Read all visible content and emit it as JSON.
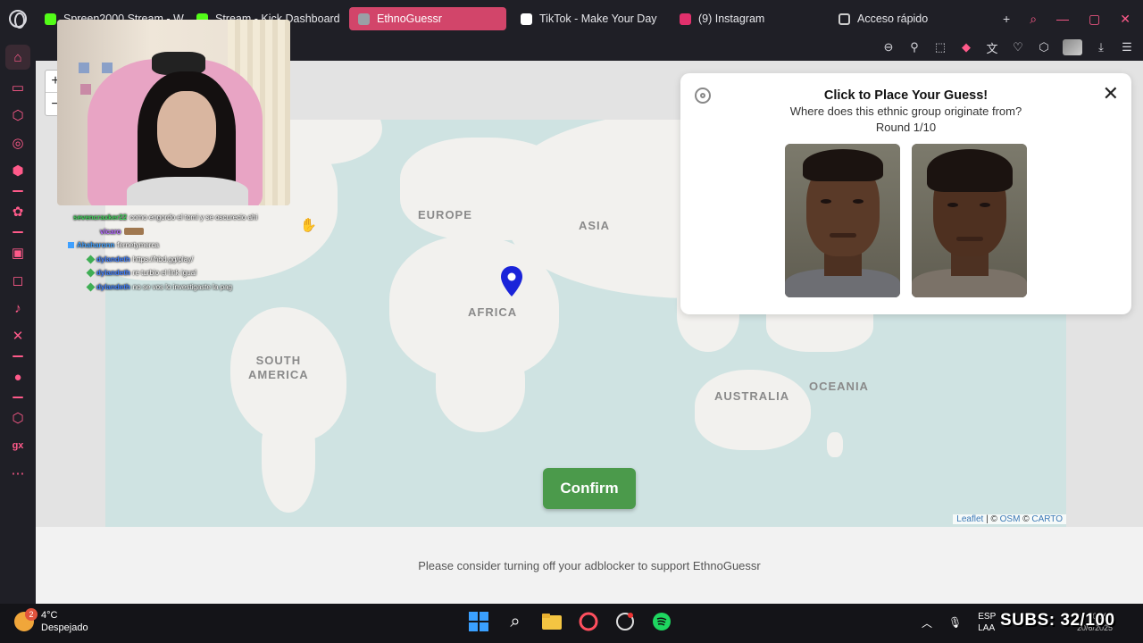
{
  "browser": {
    "tabs": [
      {
        "label": "Spreen2000 Stream - W",
        "icon": "kick-icon",
        "color": "#53fc18",
        "active": false
      },
      {
        "label": "Stream - Kick Dashboard",
        "icon": "kick-icon",
        "color": "#53fc18",
        "active": false
      },
      {
        "label": "EthnoGuessr",
        "icon": "ethnoguessr-icon",
        "color": "#9aa0a6",
        "active": true
      },
      {
        "label": "TikTok - Make Your Day",
        "icon": "tiktok-icon",
        "color": "#ffffff",
        "active": false
      },
      {
        "label": "(9) Instagram",
        "icon": "instagram-icon",
        "color": "#e1306c",
        "active": false
      },
      {
        "label": "Acceso rápido",
        "icon": "grid-icon",
        "color": "#cccccc",
        "active": false
      }
    ],
    "accent_color": "#d2456a"
  },
  "map": {
    "labels": {
      "europe": "EUROPE",
      "asia": "ASIA",
      "africa": "AFRICA",
      "south_america_1": "SOUTH",
      "south_america_2": "AMERICA",
      "australia": "AUSTRALIA",
      "oceania": "OCEANIA"
    },
    "zoom_in": "+",
    "zoom_out": "−",
    "attribution": {
      "leaflet": "Leaflet",
      "sep1": " | © ",
      "osm": "OSM",
      "sep2": " © ",
      "carto": "CARTO"
    },
    "pin_color": "#1a24d9"
  },
  "panel": {
    "title": "Click to Place Your Guess!",
    "subtitle": "Where does this ethnic group originate from?",
    "round": "Round 1/10",
    "close": "✕"
  },
  "confirm_label": "Confirm",
  "confirm_color": "#4b9a4b",
  "footer_text": "Please consider turning off your adblocker to support EthnoGuessr",
  "chat": [
    {
      "user": "sevencraxker22",
      "user_color": "#3fd15a",
      "text": "como engordo el tomi y se oscurecio ahi"
    },
    {
      "user": "vicaro",
      "user_color": "#b56bff",
      "text": ""
    },
    {
      "user": "Ahaharonn",
      "user_color": "#3fa0ff",
      "text": "fernetymerca"
    },
    {
      "user": "dylandeth",
      "user_color": "#3f7fff",
      "text": "https://hbd.gg/play/"
    },
    {
      "user": "dylandeth",
      "user_color": "#3f7fff",
      "text": "re turbio el link igual"
    },
    {
      "user": "dylandeth",
      "user_color": "#3f7fff",
      "text": "no se vos lo investigaste la pag"
    }
  ],
  "taskbar": {
    "weather_temp": "4°C",
    "weather_desc": "Despejado",
    "weather_badge": "2",
    "lang1": "ESP",
    "lang2": "LAA",
    "time": "03:04",
    "date": "20/6/2025"
  },
  "subs_overlay": "SUBS: 32/100"
}
